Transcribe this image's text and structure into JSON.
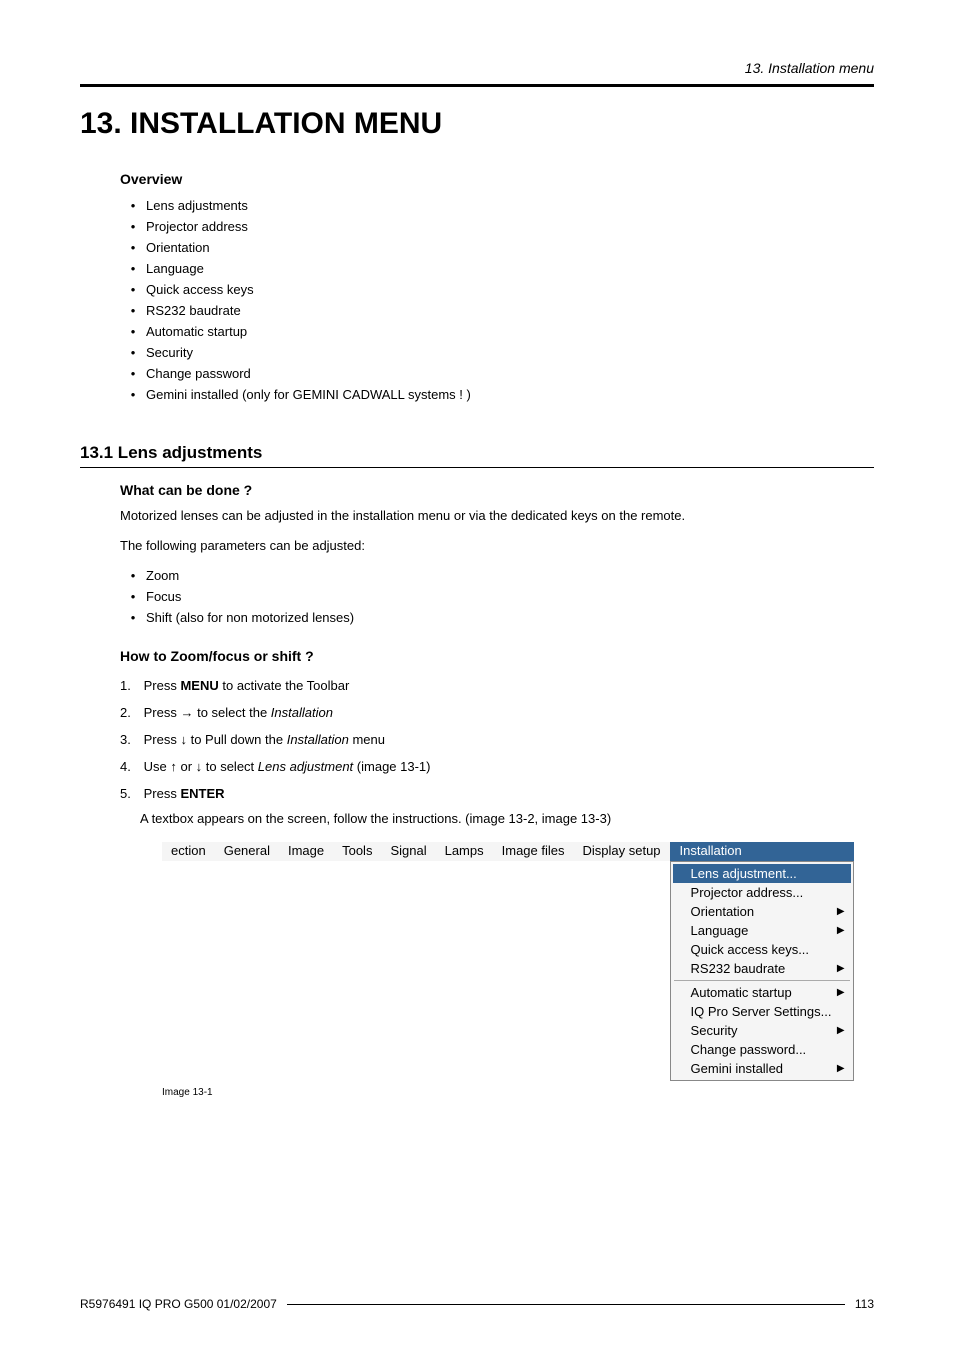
{
  "runningHeader": "13.  Installation menu",
  "chapterTitle": "13. INSTALLATION MENU",
  "overview": {
    "heading": "Overview",
    "items": [
      "Lens adjustments",
      "Projector address",
      "Orientation",
      "Language",
      "Quick access keys",
      "RS232 baudrate",
      "Automatic startup",
      "Security",
      "Change password",
      "Gemini installed (only for GEMINI CADWALL systems !  )"
    ]
  },
  "section": {
    "heading": "13.1  Lens adjustments",
    "sub1": "What can be done ?",
    "para1": "Motorized lenses can be adjusted in the installation menu or via the dedicated keys on the remote.",
    "para2": "The following parameters can be adjusted:",
    "params": [
      "Zoom",
      "Focus",
      "Shift (also for non motorized lenses)"
    ],
    "sub2": "How to Zoom/focus or shift ?",
    "steps": [
      {
        "pre": "Press ",
        "bold": "MENU",
        "post": " to activate the Toolbar"
      },
      {
        "pre": "Press → to select the ",
        "ital": "Installation",
        "post": ""
      },
      {
        "pre": "Press ↓ to Pull down the ",
        "ital": "Installation",
        "post": " menu"
      },
      {
        "pre": "Use ↑ or ↓ to select ",
        "ital": "Lens adjustment",
        "post": " (image 13-1)"
      },
      {
        "pre": "Press ",
        "bold": "ENTER",
        "post": ""
      }
    ],
    "afterSteps": "A textbox appears on the screen, follow the instructions.  (image 13-2, image 13-3)"
  },
  "menuFigure": {
    "menubar": [
      "ection",
      "General",
      "Image",
      "Tools",
      "Signal",
      "Lamps",
      "Image files",
      "Display setup"
    ],
    "menubarSelected": "Installation",
    "dropdown": [
      {
        "label": "Lens adjustment...",
        "hl": true,
        "sub": false
      },
      {
        "label": "Projector address...",
        "hl": false,
        "sub": false
      },
      {
        "label": "Orientation",
        "hl": false,
        "sub": true
      },
      {
        "label": "Language",
        "hl": false,
        "sub": true
      },
      {
        "label": "Quick access keys...",
        "hl": false,
        "sub": false
      },
      {
        "label": "RS232 baudrate",
        "hl": false,
        "sub": true
      },
      {
        "sep": true
      },
      {
        "label": "Automatic startup",
        "hl": false,
        "sub": true
      },
      {
        "label": "IQ Pro Server Settings...",
        "hl": false,
        "sub": false
      },
      {
        "label": "Security",
        "hl": false,
        "sub": true
      },
      {
        "label": "Change password...",
        "hl": false,
        "sub": false
      },
      {
        "label": "Gemini installed",
        "hl": false,
        "sub": true
      }
    ],
    "caption": "Image 13-1"
  },
  "footer": {
    "left": "R5976491  IQ PRO G500  01/02/2007",
    "right": "113"
  }
}
